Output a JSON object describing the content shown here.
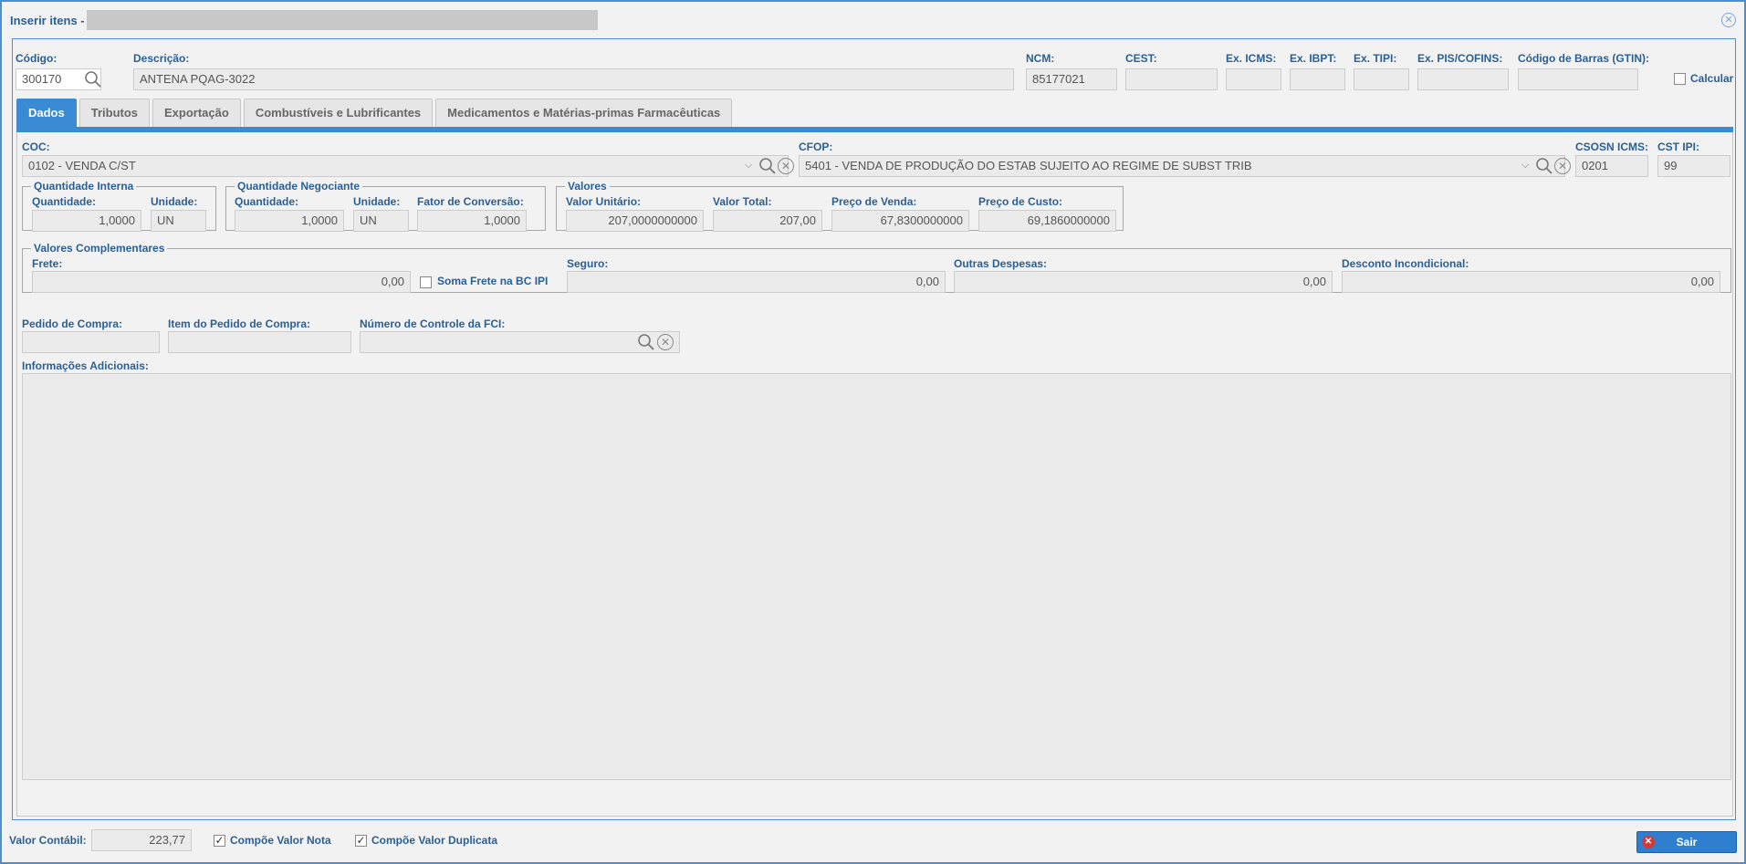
{
  "window": {
    "title": "Inserir itens -"
  },
  "header": {
    "codigo": {
      "label": "Código:",
      "value": "300170"
    },
    "descricao": {
      "label": "Descrição:",
      "value": "ANTENA PQAG-3022"
    },
    "ncm": {
      "label": "NCM:",
      "value": "85177021"
    },
    "cest": {
      "label": "CEST:",
      "value": ""
    },
    "ex_icms": {
      "label": "Ex. ICMS:",
      "value": ""
    },
    "ex_ibpt": {
      "label": "Ex. IBPT:",
      "value": ""
    },
    "ex_tipi": {
      "label": "Ex. TIPI:",
      "value": ""
    },
    "ex_pis": {
      "label": "Ex. PIS/COFINS:",
      "value": ""
    },
    "gtin": {
      "label": "Código de Barras (GTIN):",
      "value": ""
    },
    "calcular": {
      "label": "Calcular",
      "checked": false
    }
  },
  "tabs": [
    {
      "label": "Dados",
      "active": true
    },
    {
      "label": "Tributos",
      "active": false
    },
    {
      "label": "Exportação",
      "active": false
    },
    {
      "label": "Combustíveis e Lubrificantes",
      "active": false
    },
    {
      "label": "Medicamentos e Matérias-primas Farmacêuticas",
      "active": false
    }
  ],
  "dados": {
    "coc": {
      "label": "COC:",
      "value": "0102 - VENDA C/ST"
    },
    "cfop": {
      "label": "CFOP:",
      "value": "5401 - VENDA DE PRODUÇÃO DO ESTAB SUJEITO AO REGIME DE SUBST TRIB"
    },
    "csosn": {
      "label": "CSOSN ICMS:",
      "value": "0201"
    },
    "cst_ipi": {
      "label": "CST IPI:",
      "value": "99"
    },
    "qtd_interna": {
      "legend": "Quantidade Interna",
      "quantidade_label": "Quantidade:",
      "quantidade": "1,0000",
      "unidade_label": "Unidade:",
      "unidade": "UN"
    },
    "qtd_negociante": {
      "legend": "Quantidade Negociante",
      "quantidade_label": "Quantidade:",
      "quantidade": "1,0000",
      "unidade_label": "Unidade:",
      "unidade": "UN",
      "fator_label": "Fator de Conversão:",
      "fator": "1,0000"
    },
    "valores": {
      "legend": "Valores",
      "unitario_label": "Valor Unitário:",
      "unitario": "207,0000000000",
      "total_label": "Valor Total:",
      "total": "207,00",
      "venda_label": "Preço de Venda:",
      "venda": "67,8300000000",
      "custo_label": "Preço de Custo:",
      "custo": "69,1860000000"
    },
    "complementares": {
      "legend": "Valores Complementares",
      "frete_label": "Frete:",
      "frete": "0,00",
      "soma_frete_label": "Soma Frete na BC IPI",
      "seguro_label": "Seguro:",
      "seguro": "0,00",
      "outras_label": "Outras Despesas:",
      "outras": "0,00",
      "desconto_label": "Desconto Incondicional:",
      "desconto": "0,00"
    },
    "pedido_label": "Pedido de Compra:",
    "pedido": "",
    "item_pedido_label": "Item do Pedido de Compra:",
    "item_pedido": "",
    "fci_label": "Número de Controle da FCI:",
    "fci": "",
    "info_label": "Informações Adicionais:",
    "info": ""
  },
  "footer": {
    "valor_contabil_label": "Valor Contábil:",
    "valor_contabil": "223,77",
    "compoe_nota_label": "Compõe Valor Nota",
    "compoe_nota": true,
    "compoe_duplicata_label": "Compõe Valor Duplicata",
    "compoe_duplicata": true,
    "sair_label": "Sair"
  },
  "colors": {
    "accent": "#3a8bd4",
    "label": "#2a5f95",
    "danger": "#d23a3a"
  }
}
